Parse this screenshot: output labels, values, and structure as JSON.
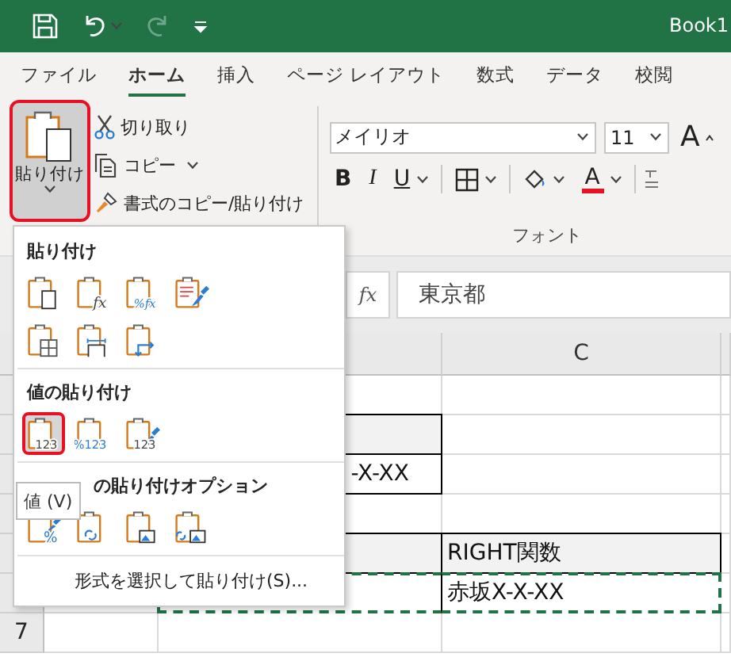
{
  "title_bar": {
    "title": "Book1",
    "quick_access": [
      {
        "kind": "save",
        "disabled": false
      },
      {
        "kind": "undo",
        "disabled": false
      },
      {
        "kind": "redo",
        "disabled": true
      },
      {
        "kind": "customize",
        "disabled": false
      }
    ]
  },
  "tabs": [
    {
      "label": "ファイル",
      "selected": false
    },
    {
      "label": "ホーム",
      "selected": true
    },
    {
      "label": "挿入",
      "selected": false
    },
    {
      "label": "ページ レイアウト",
      "selected": false
    },
    {
      "label": "数式",
      "selected": false
    },
    {
      "label": "データ",
      "selected": false
    },
    {
      "label": "校閲",
      "selected": false
    }
  ],
  "clipboard": {
    "paste": {
      "label": "貼り付け",
      "highlighted": true
    },
    "items": [
      {
        "kind": "cut",
        "label": "切り取り",
        "dropdown": false
      },
      {
        "kind": "copy",
        "label": "コピー",
        "dropdown": true
      },
      {
        "kind": "format_painter",
        "label": "書式のコピー/貼り付け",
        "dropdown": false
      }
    ]
  },
  "font_group": {
    "label": "フォント",
    "font_name": "メイリオ",
    "font_size": "11",
    "grow": "A",
    "bold": "B",
    "italic": "I",
    "underline": "U",
    "font_color": "A"
  },
  "formula_bar": {
    "function_label": "fx",
    "value": "東京都"
  },
  "sheet": {
    "column_header": "C",
    "rows": [
      {
        "cells": [
          {
            "shaded": false,
            "bordered": false,
            "marquee": false
          },
          {
            "shaded": false,
            "bordered": false,
            "marquee": false
          }
        ]
      },
      {
        "cells": [
          {
            "shaded": true,
            "bordered": true,
            "marquee": false
          },
          {
            "shaded": false,
            "bordered": false,
            "marquee": false
          }
        ]
      },
      {
        "cells": [
          {
            "text": "-X-XX",
            "shaded": false,
            "bordered": true,
            "marquee": false
          },
          {
            "shaded": false,
            "bordered": false,
            "marquee": false
          }
        ]
      },
      {
        "cells": [
          {
            "shaded": false,
            "bordered": false,
            "marquee": false
          },
          {
            "shaded": false,
            "bordered": false,
            "marquee": false
          }
        ]
      },
      {
        "cells": [
          {
            "shaded": true,
            "bordered": true,
            "marquee": false
          },
          {
            "text": "RIGHT関数",
            "shaded": true,
            "bordered": true,
            "marquee": false
          }
        ]
      },
      {
        "cells": [
          {
            "shaded": false,
            "bordered": true,
            "marquee": true
          },
          {
            "text": "赤坂X-X-XX",
            "shaded": false,
            "bordered": true,
            "marquee": true
          }
        ]
      },
      {
        "number": "7",
        "cells": [
          {
            "shaded": false,
            "bordered": false,
            "marquee": false
          },
          {
            "shaded": false,
            "bordered": false,
            "marquee": false
          }
        ]
      }
    ]
  },
  "paste_menu": {
    "sections": [
      {
        "title": "貼り付け",
        "rows": [
          {
            "options": [
              {
                "kind": "paste",
                "highlighted": false
              },
              {
                "kind": "formulas",
                "badge": "fx",
                "highlighted": false
              },
              {
                "kind": "formulas_number",
                "badge": "%fx",
                "highlighted": false
              },
              {
                "kind": "keep_source",
                "highlighted": false
              }
            ]
          },
          {
            "options": [
              {
                "kind": "no_borders",
                "highlighted": false
              },
              {
                "kind": "keep_widths",
                "highlighted": false
              },
              {
                "kind": "transpose",
                "highlighted": false
              }
            ]
          }
        ]
      },
      {
        "title": "値の貼り付け",
        "rows": [
          {
            "options": [
              {
                "kind": "values",
                "badge": "123",
                "highlighted": true
              },
              {
                "kind": "values_number",
                "badge": "%123",
                "highlighted": false
              },
              {
                "kind": "values_source",
                "badge": "123",
                "highlighted": false
              }
            ]
          }
        ]
      },
      {
        "title": "の貼り付けオプション",
        "rows": [
          {
            "options": [
              {
                "kind": "formatting",
                "badge": "%",
                "highlighted": false
              },
              {
                "kind": "link",
                "highlighted": false
              },
              {
                "kind": "picture",
                "highlighted": false
              },
              {
                "kind": "linked_picture",
                "highlighted": false
              }
            ]
          }
        ]
      }
    ],
    "footer": "形式を選択して貼り付け(S)...",
    "tooltip": "値 (V)"
  }
}
